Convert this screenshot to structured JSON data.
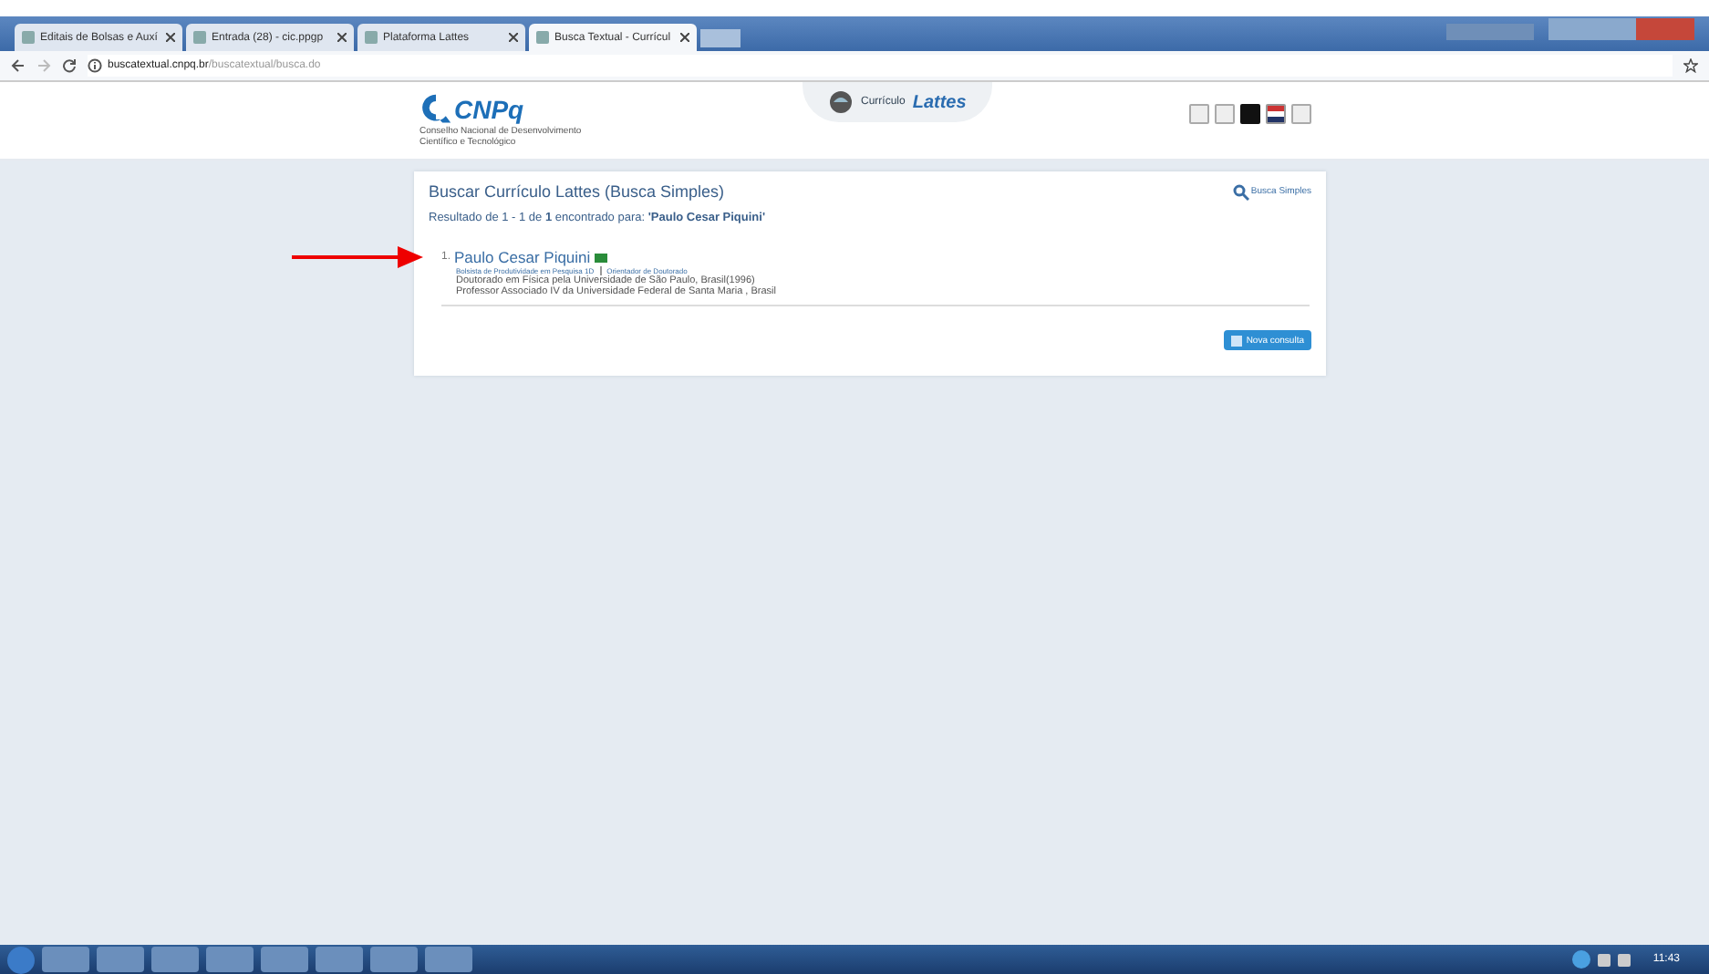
{
  "browser": {
    "tabs": [
      {
        "title": "Editais de Bolsas e Auxí",
        "selected": false
      },
      {
        "title": "Entrada (28) - cic.ppgp",
        "selected": false
      },
      {
        "title": "Plataforma Lattes",
        "selected": false
      },
      {
        "title": "Busca Textual - Currícul",
        "selected": true
      }
    ],
    "url_host": "buscatextual.cnpq.br",
    "url_path": "/buscatextual/busca.do"
  },
  "header": {
    "logo": "CNPq",
    "logo_caption": "Conselho Nacional de Desenvolvimento Científico e Tecnológico",
    "tab_prefix": "Currículo",
    "tab_title": "Lattes"
  },
  "card": {
    "title": "Buscar Currículo Lattes (Busca Simples)",
    "link": "Busca Simples",
    "result": "Resultado de 1 - 1 de **1** encontrado para: **'Paulo Cesar Piquini'**",
    "results": [
      {
        "index": "1.",
        "name": "Paulo Cesar Piquini",
        "tags": [
          "Bolsista de Produtividade em Pesquisa 1D",
          "Orientador de Doutorado"
        ],
        "lines": [
          "Doutorado em Física pela Universidade de São Paulo, Brasil(1996)",
          "Professor Associado IV da Universidade Federal de Santa Maria , Brasil"
        ]
      }
    ],
    "button": "Nova consulta"
  },
  "taskbar": {
    "time": "11:43"
  }
}
